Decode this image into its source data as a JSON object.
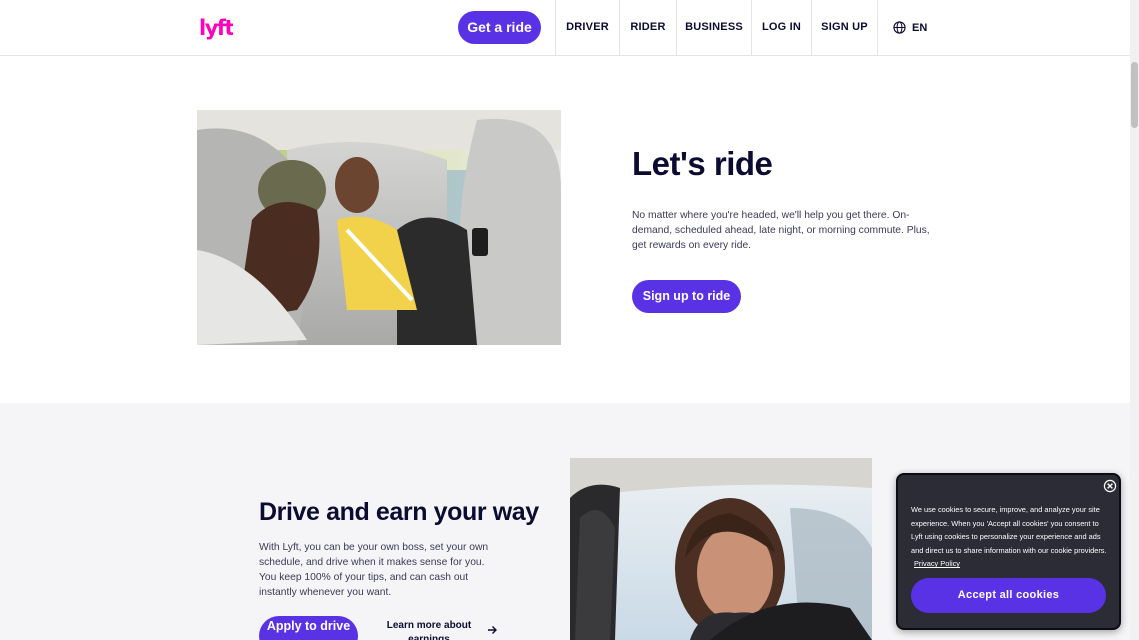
{
  "header": {
    "logo_text": "lyft",
    "get_ride_label": "Get a ride",
    "nav": {
      "driver": "DRIVER",
      "rider": "RIDER",
      "business": "BUSINESS",
      "login": "LOG IN",
      "signup": "SIGN UP"
    },
    "language": "EN"
  },
  "hero": {
    "title": "Let's ride",
    "description": "No matter where you're headed, we'll help you get there. On-demand, scheduled ahead, late night, or morning commute. Plus, get rewards on every ride.",
    "button_label": "Sign up to ride"
  },
  "driver": {
    "title": "Drive and earn your way",
    "description": "With Lyft, you can be your own boss, set your own schedule, and drive when it makes sense for you. You keep 100% of your tips, and can cash out instantly whenever you want.",
    "apply_label": "Apply to drive",
    "learn_label": "Learn more about earnings"
  },
  "cookie": {
    "text": "We use cookies to secure, improve, and analyze your site experience. When you 'Accept all cookies' you consent to Lyft using cookies to personalize your experience and ads and direct us to share information with our cookie providers.",
    "policy_link": "Privacy Policy",
    "accept_label": "Accept all cookies"
  },
  "colors": {
    "brand_pink": "#ff00bf",
    "accent_purple": "#5a32e6",
    "text_dark": "#0c0b31",
    "section_bg": "#f5f5f7",
    "cookie_bg": "#2c2c36"
  },
  "icons": [
    "lyft-logo",
    "globe-icon",
    "arrow-right-icon",
    "close-circle-icon"
  ]
}
